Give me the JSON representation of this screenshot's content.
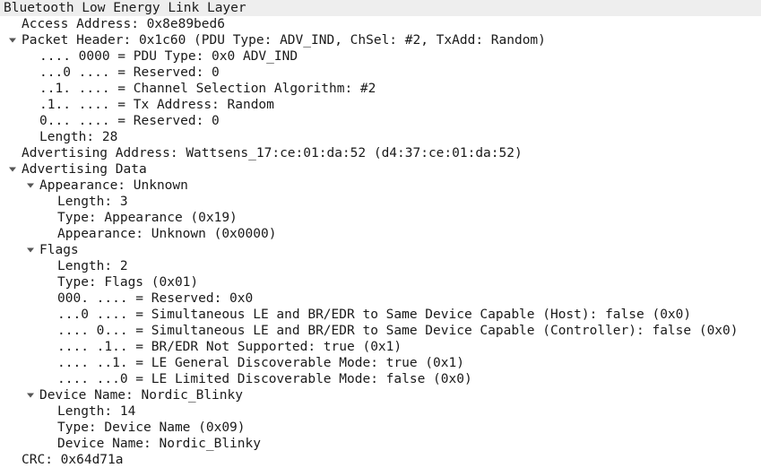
{
  "rows": [
    {
      "level": 0,
      "expander": false,
      "text": "Bluetooth Low Energy Link Layer"
    },
    {
      "level": 1,
      "expander": false,
      "text": "Access Address: 0x8e89bed6"
    },
    {
      "level": 1,
      "expander": true,
      "text": "Packet Header: 0x1c60 (PDU Type: ADV_IND, ChSel: #2, TxAdd: Random)"
    },
    {
      "level": 2,
      "expander": false,
      "text": ".... 0000 = PDU Type: 0x0 ADV_IND"
    },
    {
      "level": 2,
      "expander": false,
      "text": "...0 .... = Reserved: 0"
    },
    {
      "level": 2,
      "expander": false,
      "text": "..1. .... = Channel Selection Algorithm: #2"
    },
    {
      "level": 2,
      "expander": false,
      "text": ".1.. .... = Tx Address: Random"
    },
    {
      "level": 2,
      "expander": false,
      "text": "0... .... = Reserved: 0"
    },
    {
      "level": 2,
      "expander": false,
      "text": "Length: 28"
    },
    {
      "level": 1,
      "expander": false,
      "text": "Advertising Address: Wattsens_17:ce:01:da:52 (d4:37:ce:01:da:52)"
    },
    {
      "level": 1,
      "expander": true,
      "text": "Advertising Data"
    },
    {
      "level": 2,
      "expander": true,
      "text": "Appearance: Unknown"
    },
    {
      "level": 3,
      "expander": false,
      "text": "Length: 3"
    },
    {
      "level": 3,
      "expander": false,
      "text": "Type: Appearance (0x19)"
    },
    {
      "level": 3,
      "expander": false,
      "text": "Appearance: Unknown (0x0000)"
    },
    {
      "level": 2,
      "expander": true,
      "text": "Flags"
    },
    {
      "level": 3,
      "expander": false,
      "text": "Length: 2"
    },
    {
      "level": 3,
      "expander": false,
      "text": "Type: Flags (0x01)"
    },
    {
      "level": 3,
      "expander": false,
      "text": "000. .... = Reserved: 0x0"
    },
    {
      "level": 3,
      "expander": false,
      "text": "...0 .... = Simultaneous LE and BR/EDR to Same Device Capable (Host): false (0x0)"
    },
    {
      "level": 3,
      "expander": false,
      "text": ".... 0... = Simultaneous LE and BR/EDR to Same Device Capable (Controller): false (0x0)"
    },
    {
      "level": 3,
      "expander": false,
      "text": ".... .1.. = BR/EDR Not Supported: true (0x1)"
    },
    {
      "level": 3,
      "expander": false,
      "text": ".... ..1. = LE General Discoverable Mode: true (0x1)"
    },
    {
      "level": 3,
      "expander": false,
      "text": ".... ...0 = LE Limited Discoverable Mode: false (0x0)"
    },
    {
      "level": 2,
      "expander": true,
      "text": "Device Name: Nordic_Blinky"
    },
    {
      "level": 3,
      "expander": false,
      "text": "Length: 14"
    },
    {
      "level": 3,
      "expander": false,
      "text": "Type: Device Name (0x09)"
    },
    {
      "level": 3,
      "expander": false,
      "text": "Device Name: Nordic_Blinky"
    },
    {
      "level": 1,
      "expander": false,
      "text": "CRC: 0x64d71a"
    }
  ],
  "icons": {
    "expander": "chevron-down-icon"
  }
}
